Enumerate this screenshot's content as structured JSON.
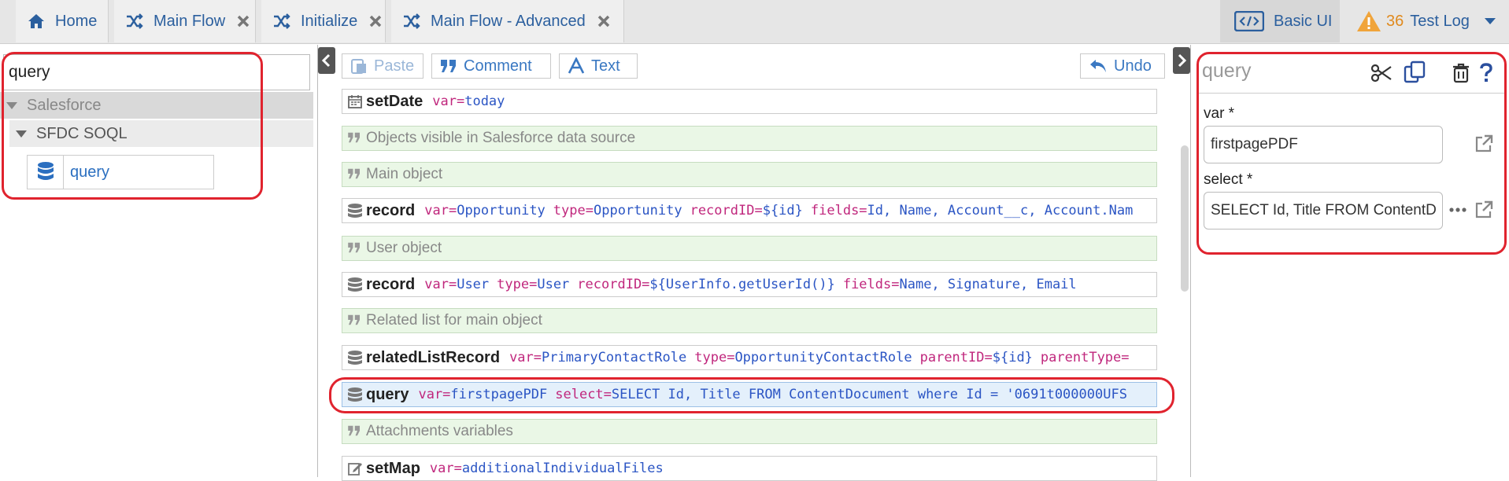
{
  "tabs": [
    {
      "label": "Home",
      "icon": "home-icon"
    },
    {
      "label": "Main Flow",
      "icon": "shuffle-icon"
    },
    {
      "label": "Initialize",
      "icon": "shuffle-icon"
    },
    {
      "label": "Main Flow - Advanced",
      "icon": "shuffle-icon"
    }
  ],
  "topbar": {
    "basic_ui": "Basic UI",
    "warning_count": "36",
    "test_log": "Test Log"
  },
  "left": {
    "search_value": "query",
    "tree": {
      "group": "Salesforce",
      "subgroup": "SFDC SOQL",
      "item": "query"
    }
  },
  "toolbar": {
    "paste": "Paste",
    "comment": "Comment",
    "text": "Text",
    "undo": "Undo"
  },
  "rows": [
    {
      "type": "cmd",
      "icon": "calendar-icon",
      "cmd": "setDate",
      "parts": [
        [
          "var=",
          "today"
        ]
      ]
    },
    {
      "type": "comment",
      "text": "Objects visible in Salesforce data source"
    },
    {
      "type": "comment",
      "text": "Main object"
    },
    {
      "type": "cmd",
      "icon": "database-icon",
      "cmd": "record",
      "parts": [
        [
          "var=",
          "Opportunity"
        ],
        [
          "type=",
          "Opportunity"
        ],
        [
          "recordID=",
          "${id}"
        ],
        [
          "fields=",
          "Id, Name, Account__c, Account.Nam"
        ]
      ]
    },
    {
      "type": "comment",
      "text": "User object"
    },
    {
      "type": "cmd",
      "icon": "database-icon",
      "cmd": "record",
      "parts": [
        [
          "var=",
          "User"
        ],
        [
          "type=",
          "User"
        ],
        [
          "recordID=",
          "${UserInfo.getUserId()}"
        ],
        [
          "fields=",
          "Name, Signature, Email"
        ]
      ]
    },
    {
      "type": "comment",
      "text": "Related list for main object"
    },
    {
      "type": "cmd",
      "icon": "database-icon",
      "cmd": "relatedListRecord",
      "parts": [
        [
          "var=",
          "PrimaryContactRole"
        ],
        [
          "type=",
          "OpportunityContactRole"
        ],
        [
          "parentID=",
          "${id}"
        ],
        [
          "parentType=",
          ""
        ]
      ]
    },
    {
      "type": "cmd",
      "icon": "database-icon",
      "cmd": "query",
      "selected": true,
      "parts": [
        [
          "var=",
          "firstpagePDF"
        ],
        [
          "select=",
          "SELECT Id, Title FROM ContentDocument where Id = '0691t000000UFS"
        ]
      ]
    },
    {
      "type": "comment",
      "text": "Attachments variables"
    },
    {
      "type": "cmd",
      "icon": "edit-icon",
      "cmd": "setMap",
      "parts": [
        [
          "var=",
          "additionalIndividualFiles"
        ]
      ]
    }
  ],
  "right": {
    "title": "query",
    "var_label": "var *",
    "var_value": "firstpagePDF",
    "select_label": "select *",
    "select_value": "SELECT Id, Title FROM ContentD"
  },
  "colors": {
    "accent": "#2b5f9e",
    "highlight": "#e0232e",
    "comment_bg": "#eaf7e6",
    "warning": "#e08a1e"
  }
}
